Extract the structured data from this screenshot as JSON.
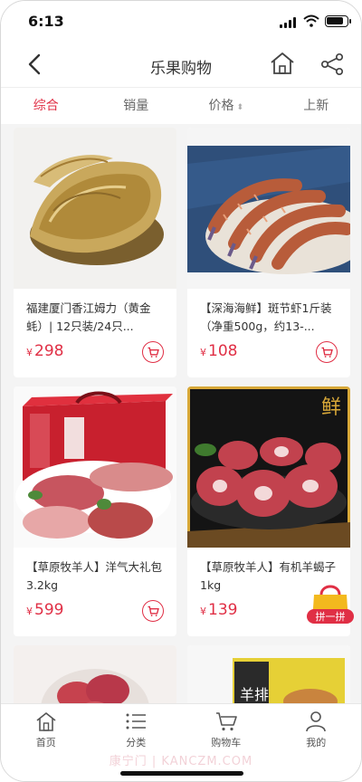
{
  "status": {
    "time": "6:13"
  },
  "nav": {
    "title": "乐果购物"
  },
  "tabs": [
    {
      "label": "综合",
      "active": true
    },
    {
      "label": "销量",
      "active": false
    },
    {
      "label": "价格",
      "active": false,
      "arrows": "⬍"
    },
    {
      "label": "上新",
      "active": false
    }
  ],
  "products": [
    {
      "name": "福建厦门香江姆力（黄金蚝）| 12只装/24只...",
      "currency": "¥",
      "price": "298",
      "image": "oyster"
    },
    {
      "name": "【深海海鲜】斑节虾1斤装（净重500g，约13-...",
      "currency": "¥",
      "price": "108",
      "image": "shrimp"
    },
    {
      "name": "【草原牧羊人】洋气大礼包3.2kg",
      "currency": "¥",
      "price": "599",
      "image": "gift-box"
    },
    {
      "name": "【草原牧羊人】有机羊蝎子1kg",
      "currency": "¥",
      "price": "139",
      "image": "lamb-spine"
    }
  ],
  "partial_products": [
    {
      "image": "meat-bowl"
    },
    {
      "image": "lamb-box",
      "label": "羊排"
    }
  ],
  "floating": {
    "label": "拼一拼"
  },
  "tabbar": [
    {
      "label": "首页",
      "icon": "home-icon"
    },
    {
      "label": "分类",
      "icon": "list-icon"
    },
    {
      "label": "购物车",
      "icon": "cart-icon"
    },
    {
      "label": "我的",
      "icon": "user-icon"
    }
  ],
  "watermark": "康宁门 | KANCZM.COM",
  "colors": {
    "accent": "#e02f45"
  }
}
